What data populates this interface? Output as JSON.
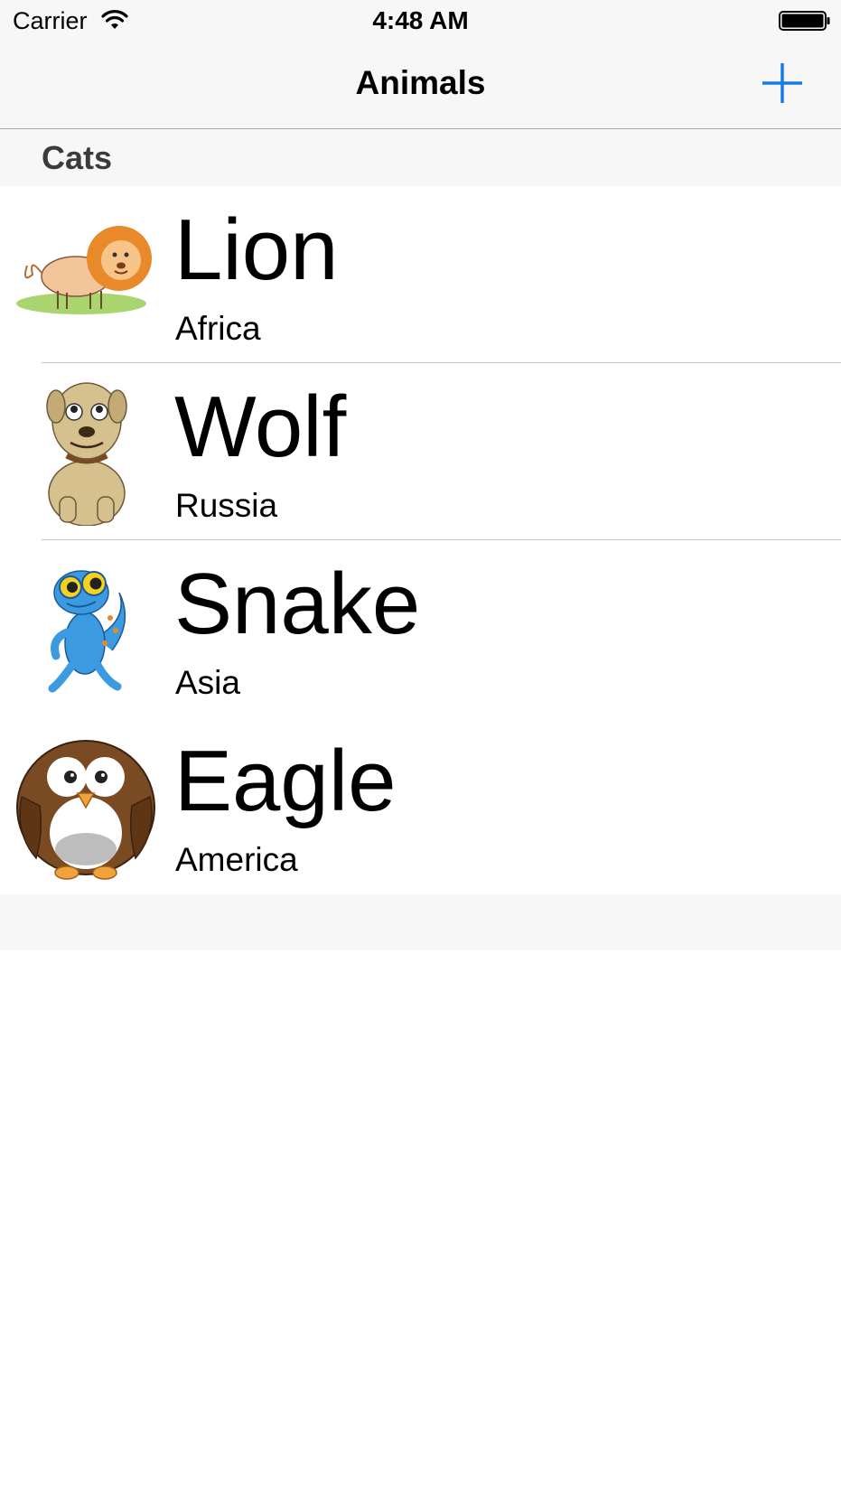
{
  "status_bar": {
    "carrier": "Carrier",
    "time": "4:48 AM",
    "wifi_icon": "wifi-icon",
    "battery_icon": "battery-icon"
  },
  "nav": {
    "title": "Animals",
    "add_icon": "plus-icon",
    "accent_color": "#1a7ae8"
  },
  "section": {
    "title": "Cats"
  },
  "rows": [
    {
      "title": "Lion",
      "subtitle": "Africa",
      "image": "lion-cartoon"
    },
    {
      "title": "Wolf",
      "subtitle": "Russia",
      "image": "dog-cartoon"
    },
    {
      "title": "Snake",
      "subtitle": "Asia",
      "image": "gecko-cartoon"
    },
    {
      "title": "Eagle",
      "subtitle": "America",
      "image": "owl-cartoon"
    }
  ]
}
